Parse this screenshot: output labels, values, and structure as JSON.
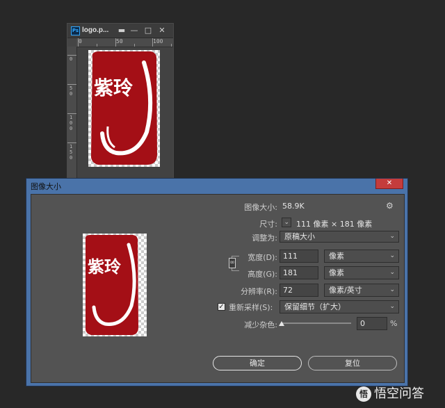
{
  "document_window": {
    "app_badge": "Ps",
    "title": "logo.p...",
    "buttons": {
      "menu": "▬",
      "minimize": "—",
      "maximize": "□",
      "close": "✕"
    },
    "ruler_top_labels": [
      "0",
      "50",
      "100"
    ],
    "ruler_left_labels": [
      "0",
      "50",
      "100",
      "150"
    ],
    "artwork_text": "紫玲"
  },
  "dialog": {
    "title": "图像大小",
    "close_glyph": "✕",
    "image_size_label": "图像大小:",
    "image_size_value": "58.9K",
    "gear_icon_glyph": "⚙",
    "dimensions_label": "尺寸:",
    "dimensions_value": "111 像素  ×  181 像素",
    "fit_to_label": "调整为:",
    "fit_to_value": "原稿大小",
    "width_label": "宽度(D):",
    "width_value": "111",
    "width_unit": "像素",
    "height_label": "高度(G):",
    "height_value": "181",
    "height_unit": "像素",
    "resolution_label": "分辨率(R):",
    "resolution_value": "72",
    "resolution_unit": "像素/英寸",
    "resample_label": "重新采样(S):",
    "resample_checked": true,
    "resample_value": "保留细节（扩大）",
    "reduce_noise_label": "减少杂色:",
    "reduce_noise_value": "0",
    "reduce_noise_unit": "%",
    "reduce_noise_level": 0,
    "ok_button": "确定",
    "reset_button": "复位"
  },
  "watermark": {
    "text": "悟空问答",
    "icon": "悟"
  },
  "colors": {
    "app_background": "#282828",
    "dialog_titlebar": "#4a73a9",
    "dialog_body": "#535353",
    "seal_red": "#a40f16",
    "ps_blue": "#31a8ff"
  }
}
